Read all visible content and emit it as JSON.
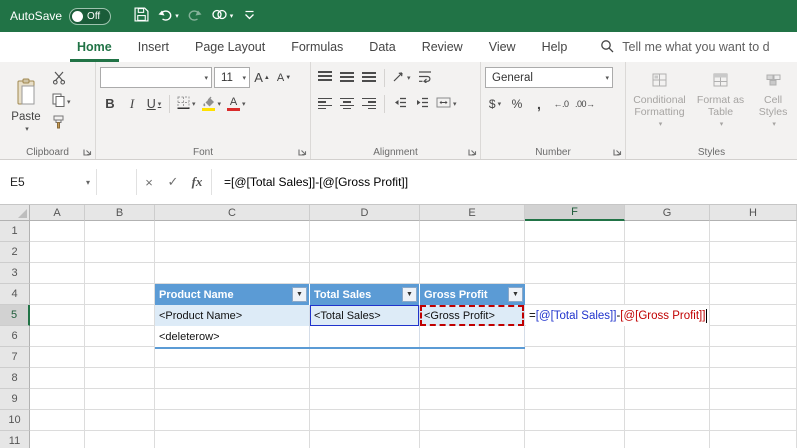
{
  "colors": {
    "excel_green": "#217346",
    "ribbon_bg": "#f3f2f1",
    "table_header_blue": "#5B9BD5",
    "banded_row_blue": "#DDEBF7",
    "ref1_blue": "#2033CC",
    "ref2_red": "#C00000"
  },
  "titlebar": {
    "autosave_label": "AutoSave",
    "autosave_state": "Off"
  },
  "tabs": [
    {
      "label": "Home",
      "active": true
    },
    {
      "label": "Insert",
      "active": false
    },
    {
      "label": "Page Layout",
      "active": false
    },
    {
      "label": "Formulas",
      "active": false
    },
    {
      "label": "Data",
      "active": false
    },
    {
      "label": "Review",
      "active": false
    },
    {
      "label": "View",
      "active": false
    },
    {
      "label": "Help",
      "active": false
    }
  ],
  "tell_me_text": "Tell me what you want to d",
  "ribbon": {
    "clipboard": {
      "group_label": "Clipboard",
      "paste_label": "Paste"
    },
    "font": {
      "group_label": "Font",
      "font_name": "",
      "font_size": "11"
    },
    "alignment": {
      "group_label": "Alignment"
    },
    "number": {
      "group_label": "Number",
      "format_value": "General"
    },
    "styles": {
      "group_label": "Styles",
      "conditional_formatting": "Conditional Formatting",
      "format_as_table": "Format as Table",
      "cell_styles": "Cell Styles"
    }
  },
  "icons": {
    "dropdown": "▾",
    "filter": "▼",
    "up_arrow": "▲",
    "down_arrow": "▼",
    "cancel": "×",
    "enter": "✓",
    "insert_function": "fx",
    "bold": "B",
    "italic": "I",
    "underline": "U",
    "grow_font_letter": "A",
    "shrink_font_letter": "A",
    "font_color_letter": "A",
    "dollar": "$",
    "percent": "%",
    "comma": ",",
    "increase_decimal": "←.0",
    "decrease_decimal": ".00→"
  },
  "formula_bar": {
    "name_box_value": "E5",
    "formula_text": "=[@[Total Sales]]-[@[Gross Profit]]"
  },
  "grid": {
    "column_headers": [
      "A",
      "B",
      "C",
      "D",
      "E",
      "F",
      "G",
      "H"
    ],
    "row_headers": [
      "1",
      "2",
      "3",
      "4",
      "5",
      "6",
      "7",
      "8",
      "9",
      "10",
      "11"
    ],
    "active_column": "F",
    "active_row": "5",
    "table": {
      "headers": [
        "Product Name",
        "Total Sales",
        "Gross Profit"
      ],
      "row5": [
        "<Product Name>",
        "<Total Sales>",
        "<Gross Profit>"
      ],
      "row6": [
        "<deleterow>",
        "",
        ""
      ]
    },
    "edit_cell": {
      "parts": {
        "eq": "=",
        "ref1": "[@[Total Sales]]",
        "minus": "-",
        "ref2": "[@[Gross Profit]]"
      }
    }
  }
}
